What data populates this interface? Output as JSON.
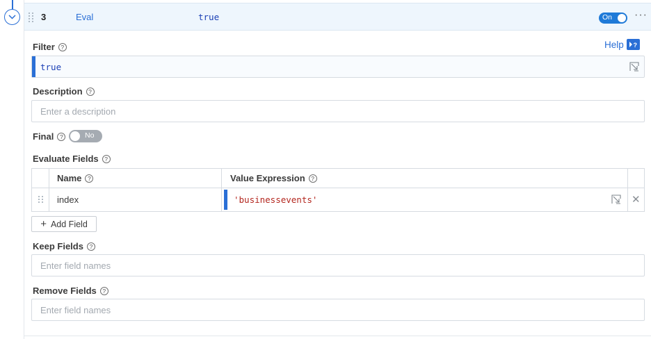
{
  "header": {
    "index": "3",
    "function": "Eval",
    "filter": "true",
    "toggle_label": "On",
    "more_label": "···"
  },
  "filter": {
    "label": "Filter",
    "value": "true",
    "help_label": "Help"
  },
  "description": {
    "label": "Description",
    "placeholder": "Enter a description"
  },
  "final": {
    "label": "Final",
    "toggle_label": "No"
  },
  "evaluate_fields": {
    "label": "Evaluate Fields",
    "columns": [
      "Name",
      "Value Expression"
    ],
    "rows": [
      {
        "name": "index",
        "value": "'businessevents'"
      }
    ],
    "add_label": "Add Field"
  },
  "keep_fields": {
    "label": "Keep Fields",
    "placeholder": "Enter field names"
  },
  "remove_fields": {
    "label": "Remove Fields",
    "placeholder": "Enter field names"
  },
  "colors": {
    "accent": "#2a6fd6",
    "header_bg": "#eef6fd",
    "string_literal": "#b3261e",
    "toggle_off": "#a5abb2"
  },
  "icons": {
    "collapse": "chevron-down-icon",
    "expand": "expand-editor-icon",
    "remove": "close-icon",
    "drag": "drag-handle-icon",
    "help": "help-panel-icon",
    "info": "question-circle-icon"
  }
}
